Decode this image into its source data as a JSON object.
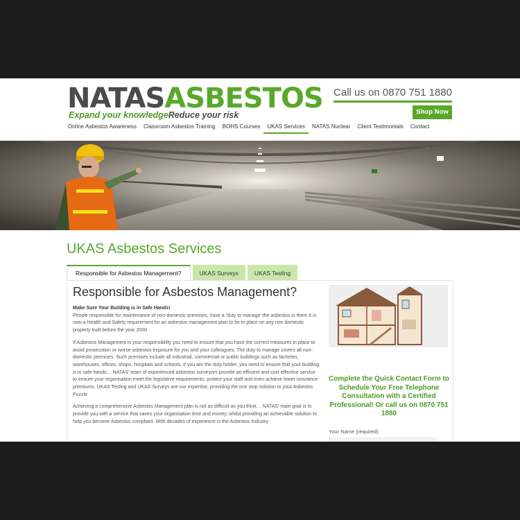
{
  "header": {
    "logo_part1": "NATAS",
    "logo_part2": "ASBESTOS",
    "tagline_part1": "Expand your knowledge",
    "tagline_part2": "Reduce your risk",
    "call_text": "Call us on 0870 751 1880",
    "shop_button": "Shop Now"
  },
  "nav": {
    "items": [
      {
        "label": "Online Asbestos Awareness"
      },
      {
        "label": "Classroom Asbestos Training"
      },
      {
        "label": "BOHS Courses"
      },
      {
        "label": "UKAS Services"
      },
      {
        "label": "NATAS Nuclear"
      },
      {
        "label": "Client Testimonials"
      },
      {
        "label": "Contact"
      }
    ],
    "active": "UKAS Services"
  },
  "page": {
    "title": "UKAS Asbestos Services"
  },
  "tabs": [
    {
      "label": "Responsible for Asbestos Management?"
    },
    {
      "label": "UKAS Surveys"
    },
    {
      "label": "UKAS Testing"
    }
  ],
  "main": {
    "heading": "Responsible for Asbestos Management?",
    "para1_bold": "Make Sure Your Building is in Safe Hands!",
    "para1": "People responsible for maintenance of non-domestic premises, have a ‘duty to manage’ the asbestos in them It is now a Health and Safety requirement for an asbestos management plan to be in place on any non domestic property built before the year 2000.",
    "para2": "If Asbestos Management is your responsibility you need to ensure that you have the correct measures in place to avoid prosecution or worse asbestos exposure for you and your colleagues.  The duty to manage covers all non-domestic premises. Such premises include all industrial, commercial or public buildings such as factories, warehouses, offices, shops, hospitals and schools. If you are the duty holder, you need to ensure that your building is in safe hands… NATAS’ team of experienced asbestos surveyors provide an efficient and cost effective service to ensure your organisation meet the legislative requirements, protect your staff and even achieve lower insurance premiums. UKAS Testing and UKAS Surveys are our expertise, providing the one stop solution to your Asbestos Puzzle",
    "para3": "Achieving a comprehensive Asbestos Management plan is not as difficult as you think…  NATAS’ main goal is to provide you with a service that saves your organisation time and money, whilst providing an achievable solution to help you become Asbestos compliant. With decades of experience in the Asbestos Industry"
  },
  "sidebar": {
    "form_heading": "Complete the Quick Contact Form to Schedule Your Free Telephone Consultation with a Certified Professional! Or call us on 0870 751 1880",
    "name_label": "Your Name (required)"
  },
  "colors": {
    "brand_green": "#5aa82a",
    "tab_inactive": "#c9e7a9",
    "logo_grey": "#4b4b4b"
  }
}
